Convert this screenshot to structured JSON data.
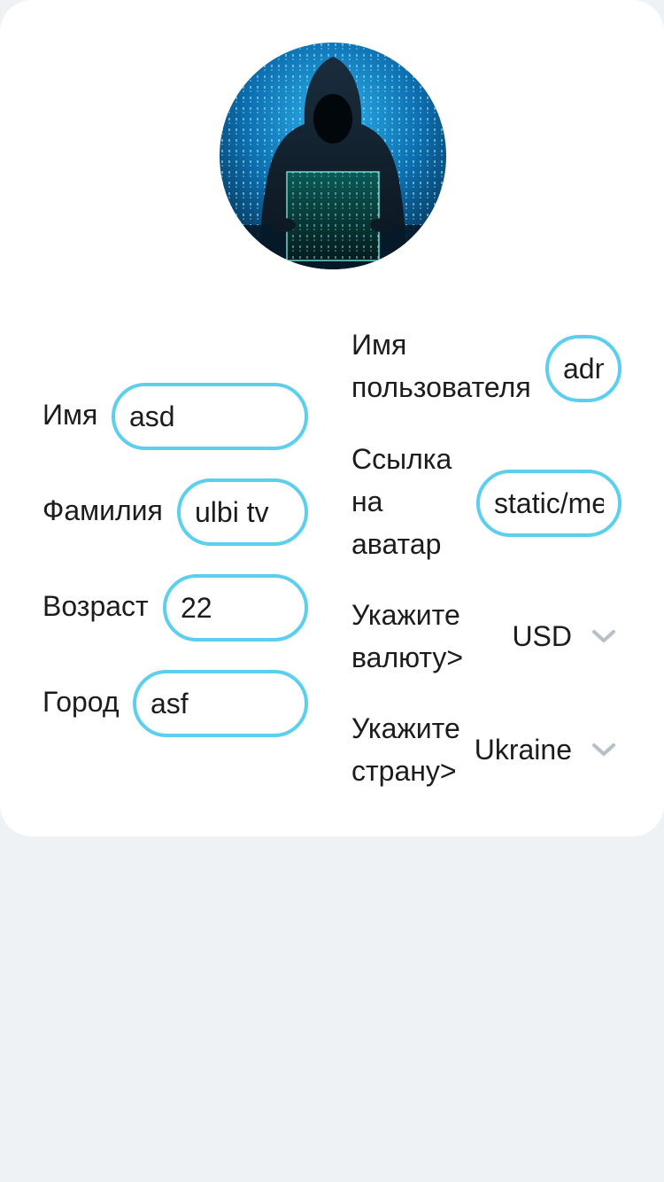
{
  "profile": {
    "first_name": {
      "label": "Имя",
      "value": "asd"
    },
    "last_name": {
      "label": "Фамилия",
      "value": "ulbi tv"
    },
    "age": {
      "label": "Возраст",
      "value": "22"
    },
    "city": {
      "label": "Город",
      "value": "asf"
    },
    "username": {
      "label_line1": "Имя",
      "label_line2": "пользователя",
      "value": "admin"
    },
    "avatar_link": {
      "label_line1": "Ссылка",
      "label_line2": "на",
      "label_line3": "аватар",
      "value": "static/media/avatar.jpg"
    },
    "currency": {
      "label_line1": "Укажите",
      "label_line2": "валюту>",
      "value": "USD"
    },
    "country": {
      "label_line1": "Укажите",
      "label_line2": "страну>",
      "value": "Ukraine"
    }
  },
  "colors": {
    "accent": "#5ccfee",
    "card": "#ffffff",
    "background": "#eef2f5",
    "text": "#1c1c1e"
  },
  "icons": {
    "avatar": "hooded-hacker-avatar",
    "dropdown": "chevron-down-icon"
  }
}
